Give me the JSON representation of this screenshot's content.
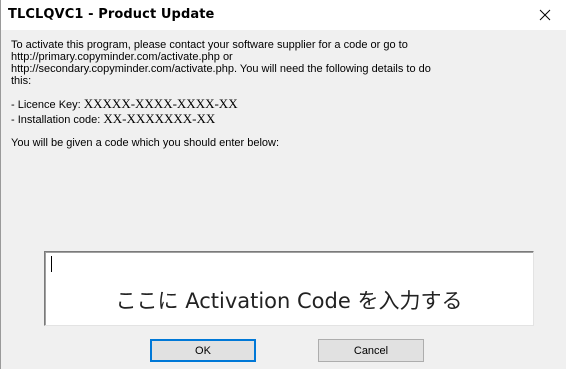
{
  "window": {
    "title": "TLCLQVC1 - Product Update",
    "close_label": "×"
  },
  "message": {
    "line1": "To activate this program, please contact your software supplier for a code or go to",
    "line2": "http://primary.copyminder.com/activate.php or",
    "line3": "http://secondary.copyminder.com/activate.php.  You will need the following details to do",
    "line4": "this:"
  },
  "details": {
    "licence_label": "- Licence Key: ",
    "licence_value": "XXXXX-XXXX-XXXX-XX",
    "install_label": "- Installation code: ",
    "install_value": "XX-XXXXXXX-XX"
  },
  "prompt": "You will be given a code which you should enter below:",
  "code_input": {
    "value": "ここに Activation Code を入力する"
  },
  "buttons": {
    "ok": "OK",
    "cancel": "Cancel"
  },
  "colors": {
    "dialog_bg": "#f0f0f0",
    "focus_border": "#0078d7"
  }
}
